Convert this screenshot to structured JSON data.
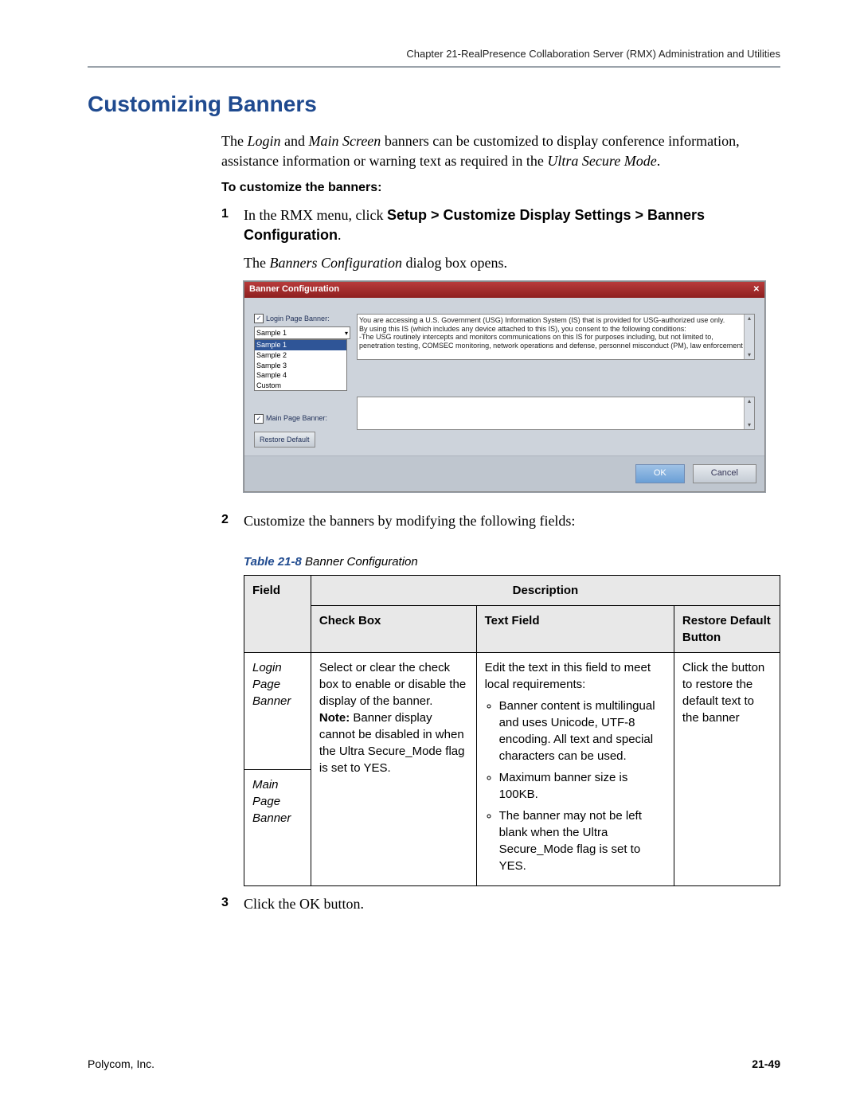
{
  "chapter_header": "Chapter 21-RealPresence Collaboration Server (RMX) Administration and Utilities",
  "heading": "Customizing Banners",
  "intro": {
    "t1": "The ",
    "i1": "Login",
    "t2": " and ",
    "i2": "Main Screen",
    "t3": " banners can be customized to display conference information, assistance information or warning text as required in the ",
    "i3": "Ultra Secure Mode",
    "t4": "."
  },
  "procedure_heading": "To customize the banners:",
  "step1": {
    "pre": "In the RMX menu, click ",
    "bold": "Setup > Customize Display Settings > Banners Configuration",
    "post": "."
  },
  "step1_sub": {
    "t1": "The ",
    "i1": "Banners Configuration",
    "t2": " dialog box opens."
  },
  "dialog": {
    "title": "Banner Configuration",
    "login_label": "Login Page Banner:",
    "combo_value": "Sample 1",
    "options": [
      "Sample 1",
      "Sample 2",
      "Sample 3",
      "Sample 4",
      "Custom"
    ],
    "banner_text_l1": "You are accessing a U.S. Government (USG) Information System (IS) that is provided for USG-authorized use only.",
    "banner_text_l2": "By using this IS (which includes any device attached to this IS), you consent to the following conditions:",
    "banner_text_l3": "-The USG routinely intercepts and monitors communications on this IS for purposes including, but not limited to, penetration testing, COMSEC monitoring, network operations and defense, personnel misconduct (PM), law enforcement",
    "main_label": "Main Page Banner:",
    "restore": "Restore Default",
    "ok": "OK",
    "cancel": "Cancel"
  },
  "step2": "Customize the banners by modifying the following fields:",
  "table_caption": {
    "num": "Table 21-8",
    "title": "  Banner Configuration"
  },
  "table": {
    "h_field": "Field",
    "h_desc": "Description",
    "h_cb": "Check Box",
    "h_tf": "Text Field",
    "h_rd": "Restore Default Button",
    "r1_field": "Login Page Banner",
    "r2_field": "Main Page Banner",
    "cb_main": "Select or clear the check box to enable or disable the display of the banner.",
    "cb_note_label": "Note:",
    "cb_note": " Banner display cannot be disabled in when the Ultra Secure_Mode flag is set to YES.",
    "tf_lead": "Edit the text in this field to meet local requirements:",
    "tf_b1": "Banner content is multilingual and uses Unicode, UTF-8 encoding. All text and special characters can be used.",
    "tf_b2": "Maximum banner size is 100KB.",
    "tf_b3": "The banner may not be left blank when the Ultra Secure_Mode flag is set to YES.",
    "rd": "Click the button to restore the default text to the banner"
  },
  "step3": "Click the OK button.",
  "footer_left": "Polycom, Inc.",
  "footer_right": "21-49"
}
